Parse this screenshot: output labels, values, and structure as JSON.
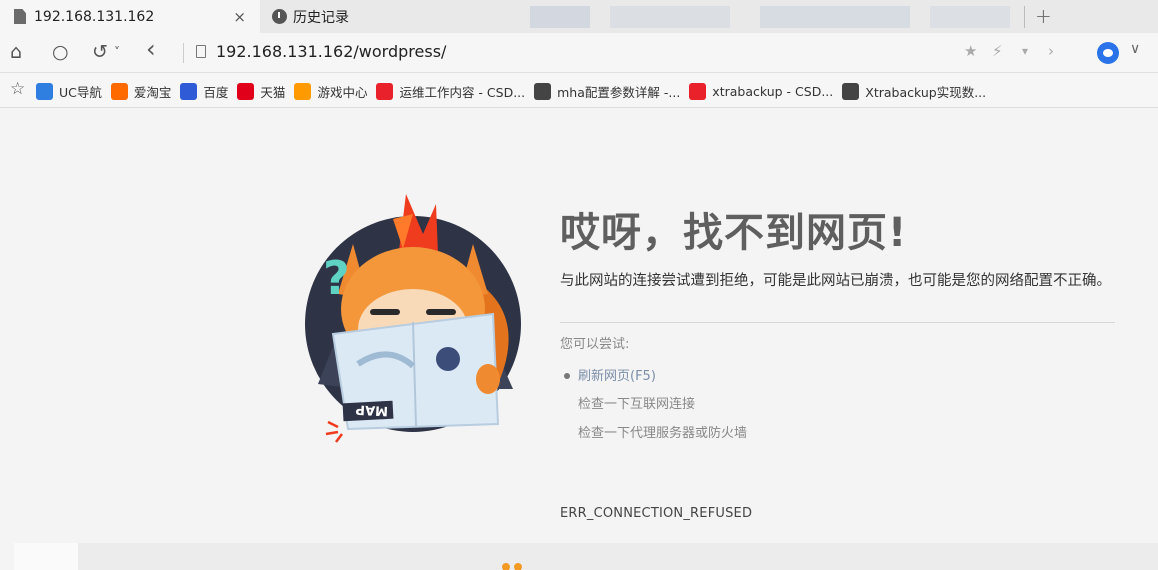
{
  "tabs": [
    {
      "title": "192.168.131.162",
      "close": "×"
    },
    {
      "title": "历史记录"
    }
  ],
  "tabbar": {
    "new_tab": "+"
  },
  "nav": {
    "home": "⌂",
    "reload": "○",
    "undo": "↺",
    "undo_caret": "˅",
    "back": "‹"
  },
  "address": {
    "url": "192.168.131.162/wordpress/",
    "star": "★",
    "bolt": "⚡",
    "caret": "▾",
    "next": "›",
    "chevron": "∨"
  },
  "bookmarks_star": "☆",
  "bookmarks": [
    {
      "label": "UC导航",
      "icon": "uc-nav-icon",
      "color": "#2f7fe0"
    },
    {
      "label": "爱淘宝",
      "icon": "taobao-icon",
      "color": "#ff6a00"
    },
    {
      "label": "百度",
      "icon": "baidu-icon",
      "color": "#2f5bd6"
    },
    {
      "label": "天猫",
      "icon": "tmall-icon",
      "color": "#e1001a"
    },
    {
      "label": "游戏中心",
      "icon": "game-center-icon",
      "color": "#ff9a00"
    },
    {
      "label": "运维工作内容 - CSD...",
      "icon": "csdn-icon",
      "color": "#e8212a"
    },
    {
      "label": "mha配置参数详解 -...",
      "icon": "blog-icon",
      "color": "#444444"
    },
    {
      "label": "xtrabackup - CSD...",
      "icon": "csdn-icon",
      "color": "#e8212a"
    },
    {
      "label": "Xtrabackup实现数...",
      "icon": "blog-icon",
      "color": "#444444"
    }
  ],
  "error": {
    "title": "哎呀，找不到网页!",
    "description": "与此网站的连接尝试遭到拒绝，可能是此网站已崩溃，也可能是您的网络配置不正确。",
    "try_label": "您可以尝试:",
    "suggestions": [
      "刷新网页(F5)",
      "检查一下互联网连接",
      "检查一下代理服务器或防火墙"
    ],
    "code": "ERR_CONNECTION_REFUSED"
  },
  "mascot": {
    "map_text": "MAP",
    "question": "?"
  },
  "colors": {
    "accent": "#f39a25",
    "link": "#7b8ea8",
    "title": "#5f5f5f"
  }
}
